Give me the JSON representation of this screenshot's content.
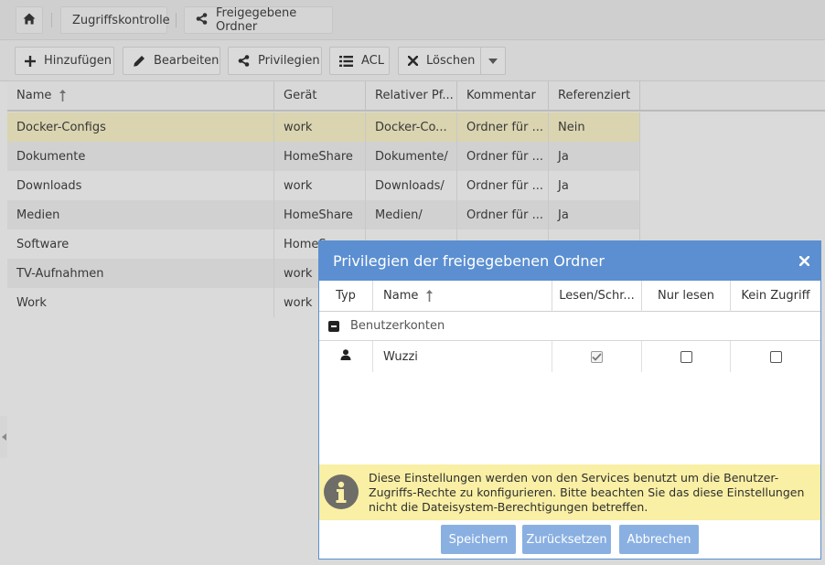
{
  "breadcrumb": {
    "home_icon": "home-icon",
    "items": [
      {
        "label": "Zugriffskontrolle"
      },
      {
        "label": "Freigegebene Ordner",
        "icon": "share-icon"
      }
    ]
  },
  "toolbar": {
    "add_label": "Hinzufügen",
    "edit_label": "Bearbeiten",
    "privileges_label": "Privilegien",
    "acl_label": "ACL",
    "delete_label": "Löschen"
  },
  "grid": {
    "columns": [
      "Name",
      "Gerät",
      "Relativer Pf...",
      "Kommentar",
      "Referenziert"
    ],
    "sort_icon": "sort-asc-icon",
    "rows": [
      {
        "name": "Docker-Configs",
        "device": "work",
        "path": "Docker-Co...",
        "comment": "Ordner für ...",
        "referenced": "Nein"
      },
      {
        "name": "Dokumente",
        "device": "HomeShare",
        "path": "Dokumente/",
        "comment": "Ordner für ...",
        "referenced": "Ja"
      },
      {
        "name": "Downloads",
        "device": "work",
        "path": "Downloads/",
        "comment": "Ordner für ...",
        "referenced": "Ja"
      },
      {
        "name": "Medien",
        "device": "HomeShare",
        "path": "Medien/",
        "comment": "Ordner für ...",
        "referenced": "Ja"
      },
      {
        "name": "Software",
        "device": "HomeS",
        "path": "",
        "comment": "",
        "referenced": ""
      },
      {
        "name": "TV-Aufnahmen",
        "device": "work",
        "path": "",
        "comment": "",
        "referenced": ""
      },
      {
        "name": "Work",
        "device": "work",
        "path": "",
        "comment": "",
        "referenced": ""
      }
    ]
  },
  "dialog": {
    "title": "Privilegien der freigegebenen Ordner",
    "columns": [
      "Typ",
      "Name",
      "Lesen/Schr...",
      "Nur lesen",
      "Kein Zugriff"
    ],
    "group_label": "Benutzerkonten",
    "users": [
      {
        "type_icon": "user-icon",
        "name": "Wuzzi",
        "read_write": true,
        "read_only": false,
        "no_access": false
      }
    ],
    "info_text": "Diese Einstellungen werden von den Services benutzt um die Benutzer-Zugriffs-Rechte zu konfigurieren. Bitte beachten Sie das diese Einstellungen nicht die Dateisystem-Berechtigungen betreffen.",
    "save_label": "Speichern",
    "reset_label": "Zurücksetzen",
    "cancel_label": "Abbrechen"
  },
  "colors": {
    "dialog_header": "#5b8fd1",
    "dialog_button": "#8ab0e2",
    "selected_row": "#f3ecc2",
    "info_background": "#f9efa5"
  }
}
